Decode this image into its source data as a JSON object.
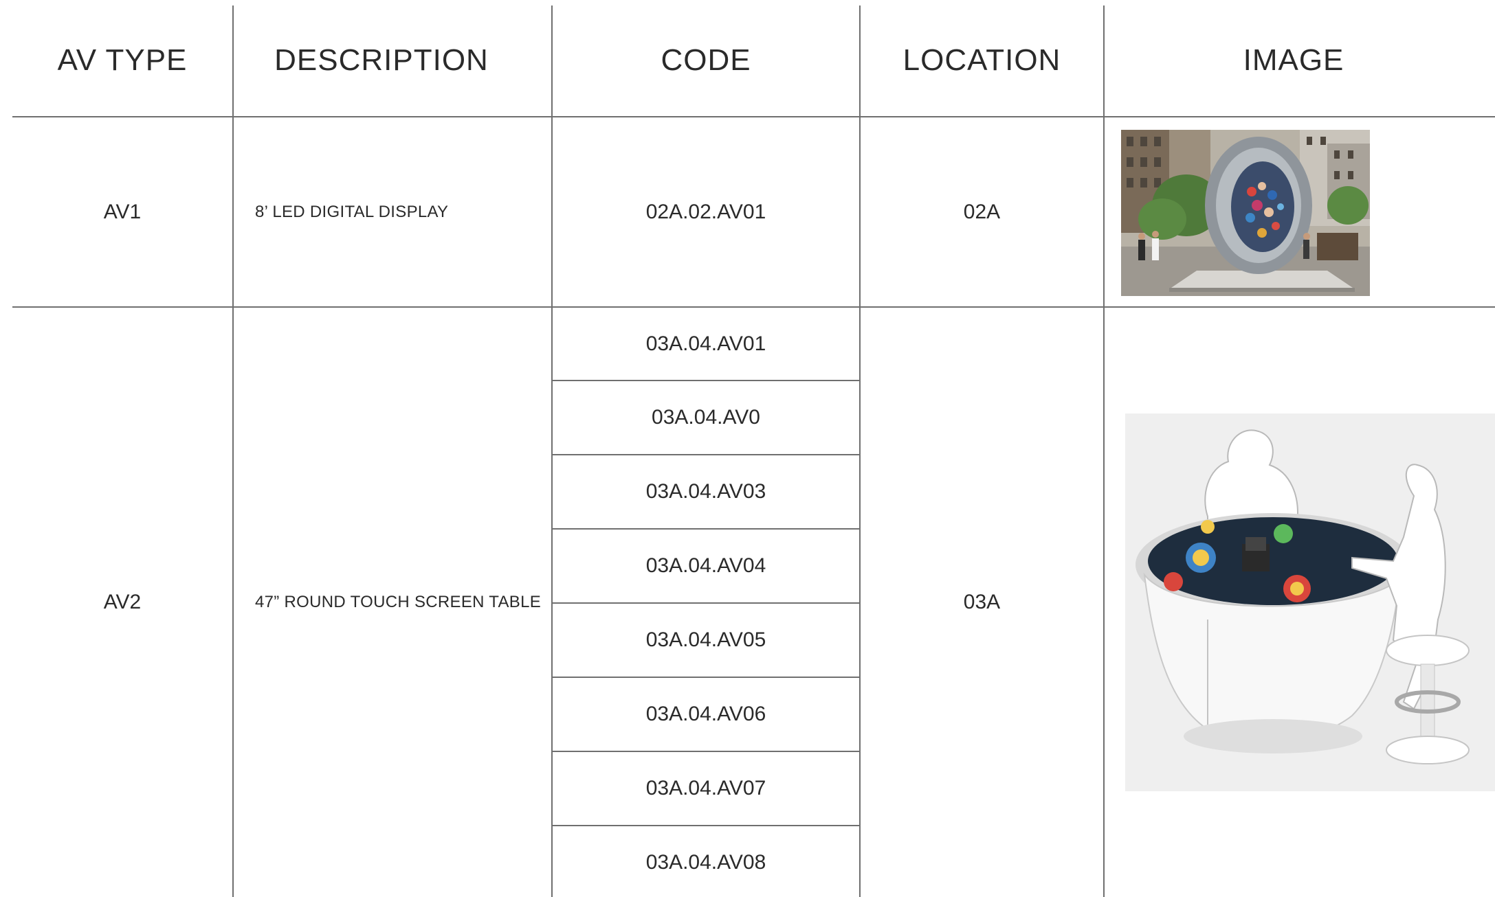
{
  "table": {
    "headers": {
      "av_type": "AV TYPE",
      "description": "DESCRIPTION",
      "code": "CODE",
      "location": "LOCATION",
      "image": "IMAGE"
    },
    "rows": [
      {
        "av_type": "AV1",
        "description": "8’ LED DIGITAL DISPLAY",
        "codes": [
          "02A.02.AV01"
        ],
        "location": "02A",
        "image": "led-portal-display-photo"
      },
      {
        "av_type": "AV2",
        "description": "47” ROUND TOUCH SCREEN TABLE",
        "codes": [
          "03A.04.AV01",
          "03A.04.AV0",
          "03A.04.AV03",
          "03A.04.AV04",
          "03A.04.AV05",
          "03A.04.AV06",
          "03A.04.AV07",
          "03A.04.AV08"
        ],
        "location": "03A",
        "image": "round-touch-table-render"
      }
    ]
  },
  "colors": {
    "line": "#6f6f6f",
    "text": "#2a2a2a",
    "background": "#ffffff"
  }
}
